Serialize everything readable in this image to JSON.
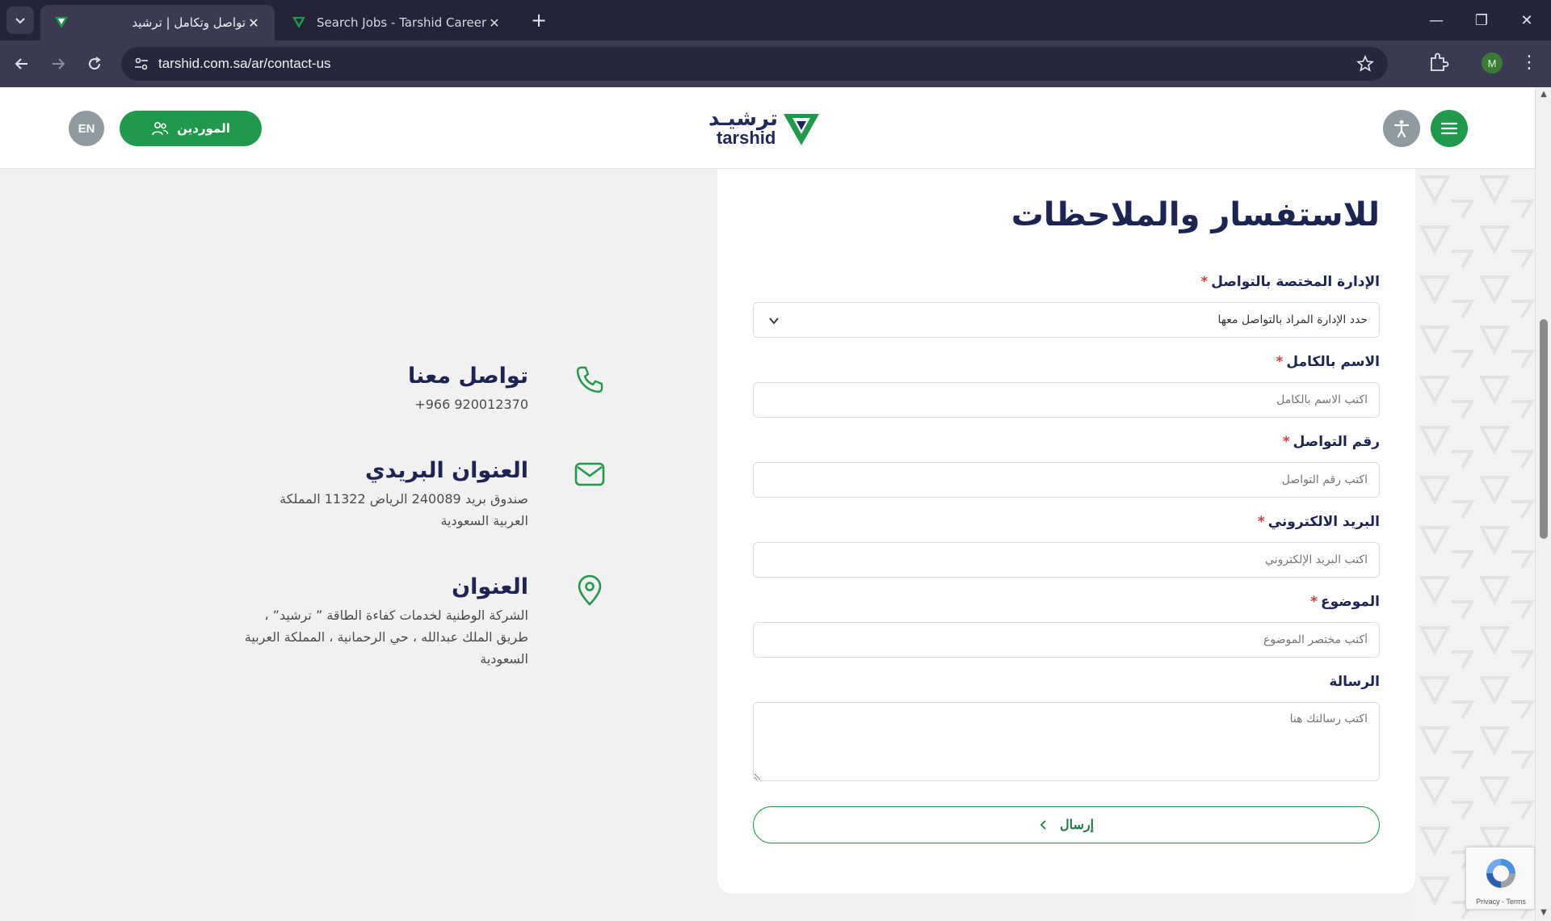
{
  "browser": {
    "tabs": [
      {
        "title": "تواصل وتكامل | ترشيد",
        "active": true
      },
      {
        "title": "Search Jobs - Tarshid Careers",
        "active": false
      }
    ],
    "url": "tarshid.com.sa/ar/contact-us",
    "profile_initial": "M"
  },
  "header": {
    "lang_label": "EN",
    "suppliers_label": "الموردين",
    "logo_ar": "ترشيـد",
    "logo_en": "tarshid"
  },
  "form": {
    "title": "للاستفسار والملاحظات",
    "required_mark": "*",
    "department": {
      "label": "الإدارة المختصة بالتواصل",
      "value": "حدد الإدارة المراد بالتواصل معها"
    },
    "full_name": {
      "label": "الاسم بالكامل",
      "placeholder": "اكتب الاسم بالكامل"
    },
    "phone": {
      "label": "رقم التواصل",
      "placeholder": "اكتب رقم التواصل"
    },
    "email": {
      "label": "البريد الالكتروني",
      "placeholder": "اكتب البريد الإلكتروني"
    },
    "subject": {
      "label": "الموضوع",
      "placeholder": "أكتب مختصر الموضوع"
    },
    "message": {
      "label": "الرسالة",
      "placeholder": "اكتب رسالتك هنا"
    },
    "submit_label": "إرسال"
  },
  "contact": {
    "phone_title": "تواصل معنا",
    "phone_value": "+966 920012370",
    "mail_title": "العنوان البريدي",
    "mail_value": "صندوق بريد 240089 الرياض 11322 المملكة العربية السعودية",
    "address_title": "العنوان",
    "address_value": "الشركة الوطنية لخدمات كفاءة الطاقة ” ترشيد” ، طريق الملك عبدالله ، حي الرحمانية ، المملكة العربية السعودية"
  },
  "recaptcha": {
    "links": "Privacy - Terms"
  },
  "colors": {
    "brand_green": "#1f9a4b",
    "navy": "#1c2454",
    "required_red": "#d23b3b"
  }
}
